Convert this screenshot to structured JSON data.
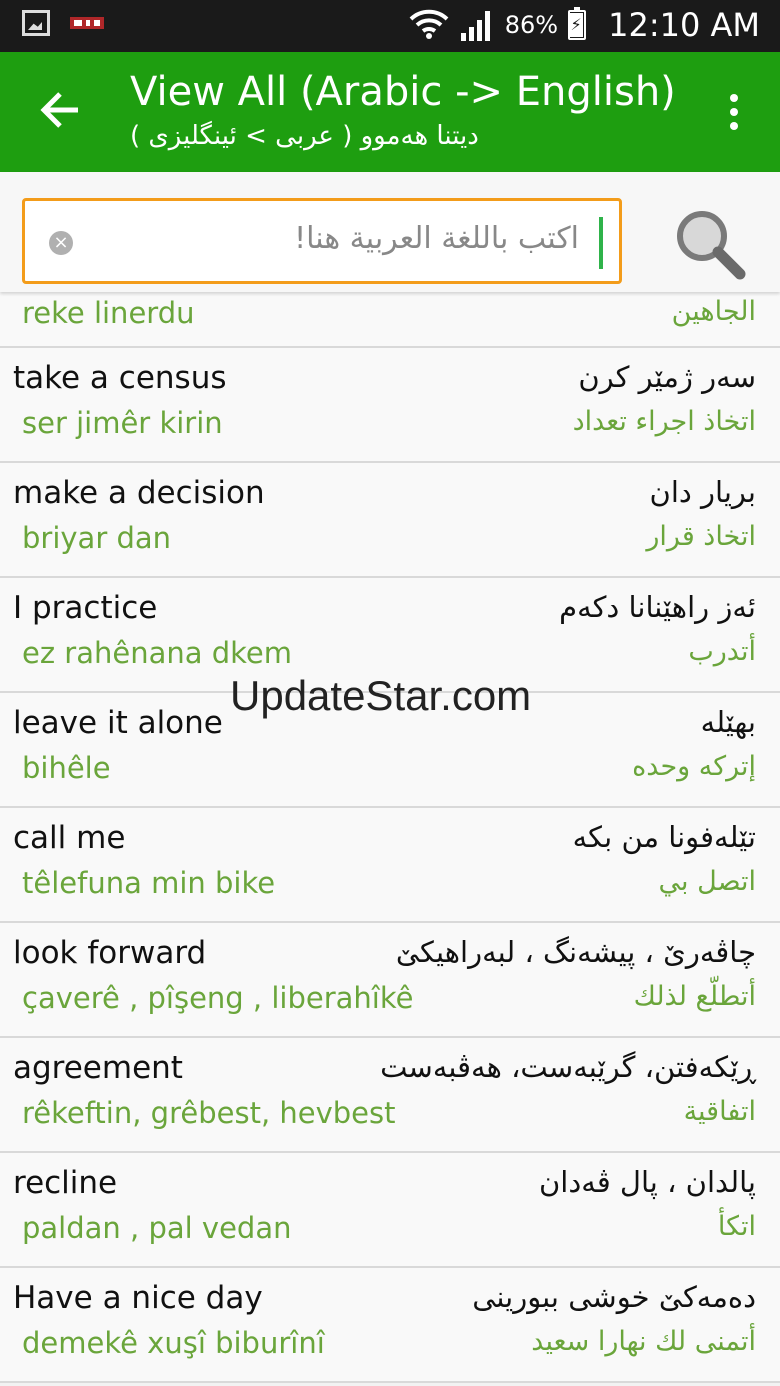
{
  "status": {
    "battery": "86%",
    "time": "12:10 AM"
  },
  "appbar": {
    "title": "View All (Arabic -> English)",
    "subtitle": "دیتنا هەموو ( عربی > ئینگلیزی )"
  },
  "search": {
    "placeholder": "اكتب باللغة العربية هنا!"
  },
  "partial_row": {
    "translit": "reke linerdu",
    "arabic": "الجاهين"
  },
  "rows": [
    {
      "english": "take a census",
      "translit": "ser jimêr kirin",
      "kurdish": "سەر ژمێر کرن",
      "arabic": "اتخاذ اجراء تعداد"
    },
    {
      "english": "make a decision",
      "translit": "briyar dan",
      "kurdish": "بریار دان",
      "arabic": "اتخاذ قرار"
    },
    {
      "english": "I practice",
      "translit": "ez rahênana dkem",
      "kurdish": "ئەز راهێنانا دکەم",
      "arabic": "أتدرب"
    },
    {
      "english": "leave it alone",
      "translit": "bihêle",
      "kurdish": "بهێله",
      "arabic": "إتركه وحده"
    },
    {
      "english": "call me",
      "translit": "têlefuna min bike",
      "kurdish": "تێلەفونا من بکه",
      "arabic": "اتصل بي"
    },
    {
      "english": "look forward",
      "translit": "çaverê , pîşeng , liberahîkê",
      "kurdish": "چاڤەرێ ، پیشەنگ ، لبەراهیکێ",
      "arabic": "أتطلّع لذلك"
    },
    {
      "english": "agreement",
      "translit": "rêkeftin, grêbest, hevbest",
      "kurdish": "ڕێکەفتن، گرێبەست، هەڤبەست",
      "arabic": "اتفاقية"
    },
    {
      "english": "recline",
      "translit": "paldan ,  pal vedan",
      "kurdish": "پالدان ، پال ڤەدان",
      "arabic": "اتكأ"
    },
    {
      "english": "Have a nice day",
      "translit": "demekê xuşî biburînî",
      "kurdish": "دەمەکێ خوشی ببورینی",
      "arabic": "أتمنى لك نهارا سعيد"
    }
  ],
  "watermark": "UpdateStar.com",
  "colors": {
    "appbar": "#1e9e10",
    "accent_text": "#6aa53b",
    "search_border": "#f39c1a"
  }
}
